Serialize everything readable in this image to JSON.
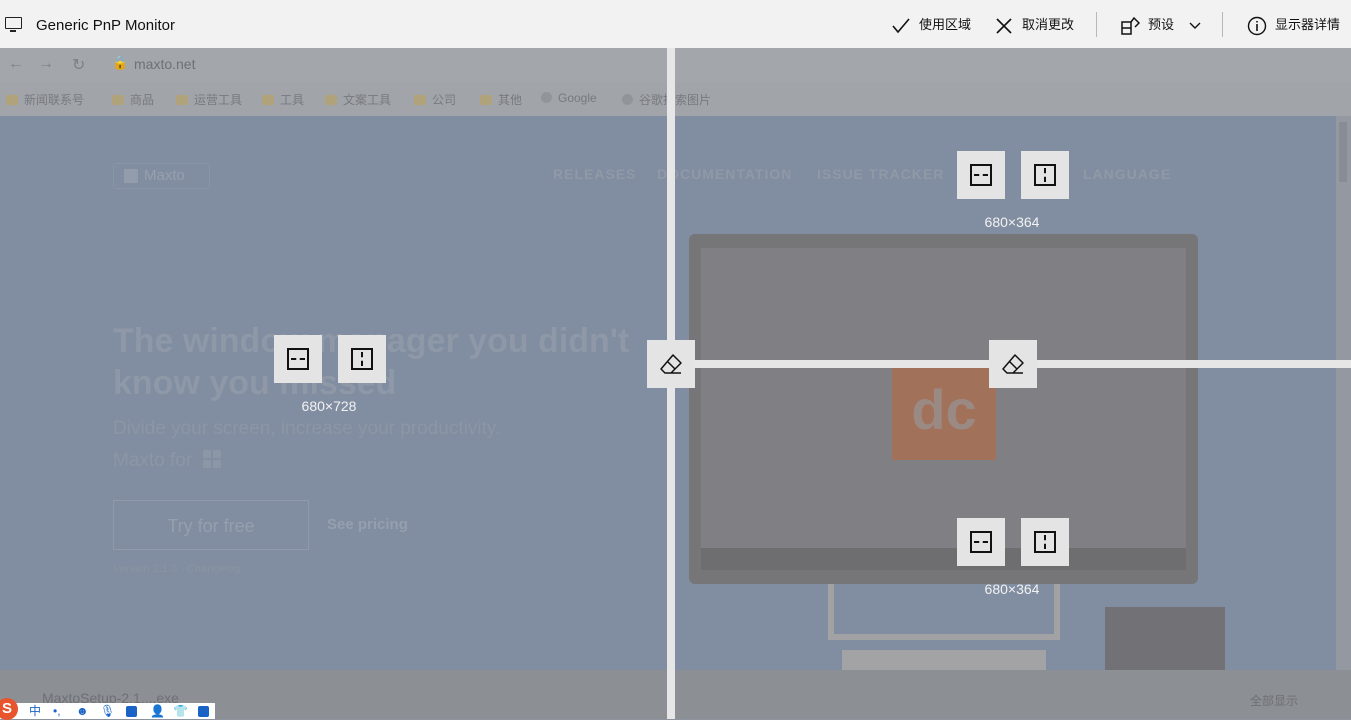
{
  "monitor": {
    "name": "Generic PnP Monitor"
  },
  "toolbar": {
    "use_zone": "使用区域",
    "cancel_changes": "取消更改",
    "presets": "预设",
    "display_details": "显示器详情"
  },
  "zones": {
    "left": {
      "size": "680×728"
    },
    "top_right": {
      "size": "680×364"
    },
    "bottom_right": {
      "size": "680×364"
    }
  },
  "background_browser": {
    "url": "maxto.net",
    "bookmarks": [
      "新闻联系号",
      "商品",
      "运营工具",
      "工具",
      "文案工具",
      "公司",
      "其他",
      "Google",
      "谷歌搜索图片"
    ],
    "site": {
      "logo": "Maxto",
      "nav": [
        "RELEASES",
        "DOCUMENTATION",
        "ISSUE TRACKER",
        "LANGUAGE"
      ],
      "hero_line1": "The window manager you didn't",
      "hero_line2": "know you missed",
      "subtitle": "Divide your screen, increase your productivity.",
      "maxto_for": "Maxto for",
      "try_button": "Try for free",
      "pricing_link": "See pricing",
      "version": "Version 2.1.0 · Changelog"
    },
    "download_item": "MaxtoSetup-2.1....exe",
    "show_all": "全部显示"
  },
  "ime": {
    "mode": "中"
  },
  "colors": {
    "overlay_bar": "#f2f2f2",
    "divider": "#e6e6e6",
    "control_bg": "#e4e4e4",
    "ime_blue": "#1a63c6",
    "ime_logo": "#e8542b"
  }
}
